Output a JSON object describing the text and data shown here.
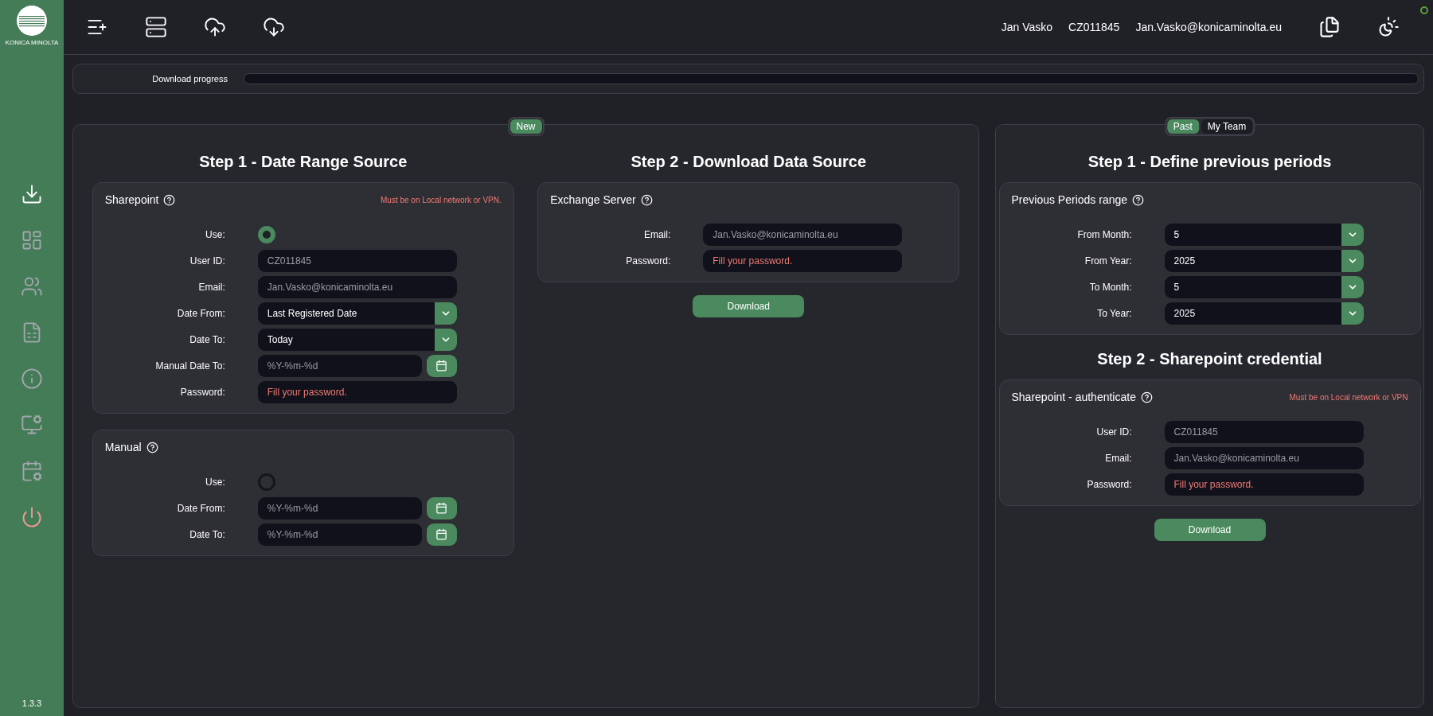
{
  "sidebar": {
    "logo_text": "KONICA MINOLTA",
    "items": [
      {
        "kind": "nav",
        "selected": true
      },
      {
        "kind": "nav",
        "selected": false
      },
      {
        "kind": "nav",
        "selected": false
      },
      {
        "kind": "nav",
        "selected": false
      },
      {
        "kind": "nav",
        "selected": false
      },
      {
        "kind": "nav",
        "selected": false
      },
      {
        "kind": "nav",
        "selected": false
      },
      {
        "kind": "power",
        "selected": false
      }
    ],
    "version": "1.3.3"
  },
  "user": {
    "name": "Jan Vasko",
    "id": "CZ011845",
    "email": "Jan.Vasko@konicaminolta.eu"
  },
  "download_progress": {
    "label": "Download progress",
    "level": 0
  },
  "left_panel": {
    "tabs": [
      {
        "label": "New",
        "selected": true
      }
    ],
    "columns": [
      {
        "title": "Step 1 - Date Range Source",
        "cards": [
          {
            "title": "Sharepoint",
            "note": "Must be on Local network or VPN.",
            "fields": [
              {
                "label": "Use:",
                "kind": "radio",
                "selected": true
              },
              {
                "label": "User ID:",
                "kind": "text",
                "value": "CZ011845",
                "disabled": true
              },
              {
                "label": "Email:",
                "kind": "text",
                "value": "Jan.Vasko@konicaminolta.eu",
                "disabled": true
              },
              {
                "label": "Date From:",
                "kind": "select",
                "value": "Last Registered Date"
              },
              {
                "label": "Date To:",
                "kind": "select",
                "value": "Today"
              },
              {
                "label": "Manual Date To:",
                "kind": "date",
                "placeholder": "%Y-%m-%d"
              },
              {
                "label": "Password:",
                "kind": "password",
                "placeholder": "Fill your password."
              }
            ]
          },
          {
            "title": "Manual",
            "fields": [
              {
                "label": "Use:",
                "kind": "radio",
                "selected": false
              },
              {
                "label": "Date From:",
                "kind": "date",
                "placeholder": "%Y-%m-%d"
              },
              {
                "label": "Date To:",
                "kind": "date",
                "placeholder": "%Y-%m-%d"
              }
            ]
          }
        ]
      },
      {
        "title": "Step 2 - Download Data Source",
        "cards": [
          {
            "title": "Exchange Server",
            "fields": [
              {
                "label": "Email:",
                "kind": "text",
                "value": "Jan.Vasko@konicaminolta.eu",
                "disabled": true
              },
              {
                "label": "Password:",
                "kind": "password",
                "placeholder": "Fill your password."
              }
            ]
          }
        ],
        "button": "Download"
      }
    ]
  },
  "right_panel": {
    "tabs": [
      {
        "label": "Past",
        "selected": true
      },
      {
        "label": "My Team",
        "selected": false
      }
    ],
    "columns": [
      {
        "title": "Step 1 - Define previous periods",
        "cards": [
          {
            "title": "Previous Periods range",
            "fields": [
              {
                "label": "From Month:",
                "kind": "select",
                "value": "5"
              },
              {
                "label": "From Year:",
                "kind": "select",
                "value": "2025"
              },
              {
                "label": "To Month:",
                "kind": "select",
                "value": "5"
              },
              {
                "label": "To Year:",
                "kind": "select",
                "value": "2025"
              }
            ]
          }
        ]
      },
      {
        "title": "Step 2 - Sharepoint credential",
        "cards": [
          {
            "title": "Sharepoint - authenticate",
            "note": "Must be on Local network or VPN",
            "fields": [
              {
                "label": "User ID:",
                "kind": "text",
                "value": "CZ011845",
                "disabled": true
              },
              {
                "label": "Email:",
                "kind": "text",
                "value": "Jan.Vasko@konicaminolta.eu",
                "disabled": true
              },
              {
                "label": "Password:",
                "kind": "password",
                "placeholder": "Fill your password."
              }
            ]
          }
        ],
        "button": "Download"
      }
    ]
  }
}
